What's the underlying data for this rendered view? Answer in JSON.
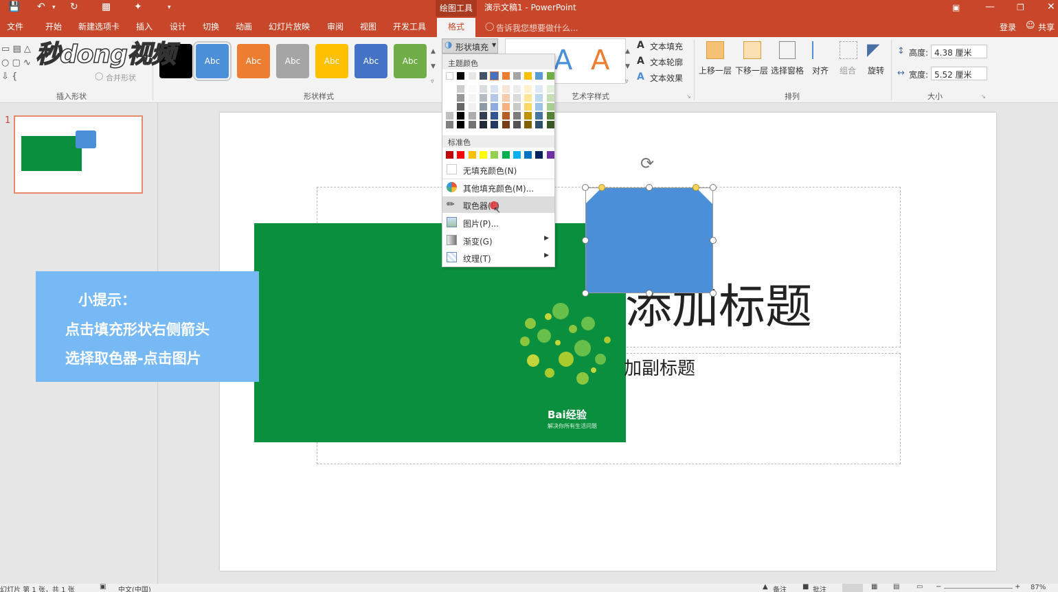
{
  "titlebar": {
    "context_tab": "绘图工具",
    "doc_title": "演示文稿1 - PowerPoint"
  },
  "tabs": [
    "文件",
    "开始",
    "新建选项卡",
    "插入",
    "设计",
    "切换",
    "动画",
    "幻灯片放映",
    "审阅",
    "视图",
    "开发工具",
    "格式"
  ],
  "search": {
    "placeholder": "告诉我您想要做什么..."
  },
  "account": {
    "login": "登录",
    "share": "共享"
  },
  "ribbon": {
    "merge_shapes": "合并形状",
    "group_insert_shape": "插入形状",
    "group_shape_styles": "形状样式",
    "style_label": "Abc",
    "shape_fill": "形状填充",
    "group_wordart": "艺术字样式",
    "wordart_letter": "A",
    "text_fill": "文本填充",
    "text_outline": "文本轮廓",
    "text_effect": "文本效果",
    "bring_forward": "上移一层",
    "send_backward": "下移一层",
    "selection_pane": "选择窗格",
    "align": "对齐",
    "group": "组合",
    "rotate": "旋转",
    "group_arrange": "排列",
    "height_label": "高度:",
    "height_value": "4.38 厘米",
    "width_label": "宽度:",
    "width_value": "5.52 厘米",
    "group_size": "大小"
  },
  "watermark": "秒dong视频",
  "thumbnail": {
    "number": "1"
  },
  "dropdown": {
    "theme_colors": "主题颜色",
    "standard_colors": "标准色",
    "no_fill": "无填充颜色(N)",
    "more_colors": "其他填充颜色(M)...",
    "eyedropper": "取色器(E)",
    "picture": "图片(P)...",
    "gradient": "渐变(G)",
    "texture": "纹理(T)"
  },
  "slide": {
    "title_text": "添加标题",
    "subtitle_text": "加副标题",
    "baidu_logo": "Bai经验",
    "baidu_slogan": "解决你所有生活问题"
  },
  "tip": {
    "heading": "小提示：",
    "line1": "点击填充形状右侧箭头",
    "line2": "选择取色器-点击图片"
  },
  "status": {
    "slide_info": "幻灯片 第 1 张，共 1 张",
    "language": "中文(中国)",
    "notes": "备注",
    "comments": "批注",
    "zoom": "87%"
  },
  "colors": {
    "accent": "#c8472a",
    "slide_green": "#0a8f3f",
    "shape_blue": "#4a8fd8",
    "tip_blue": "#77b9f5"
  },
  "theme_palette": [
    "#ffffff",
    "#000000",
    "#e7e6e6",
    "#44546a",
    "#4472c4",
    "#ed7d31",
    "#a5a5a5",
    "#ffc000",
    "#5b9bd5",
    "#70ad47"
  ],
  "standard_palette": [
    "#c00000",
    "#ff0000",
    "#ffc000",
    "#ffff00",
    "#92d050",
    "#00b050",
    "#00b0f0",
    "#0070c0",
    "#002060",
    "#7030a0"
  ]
}
